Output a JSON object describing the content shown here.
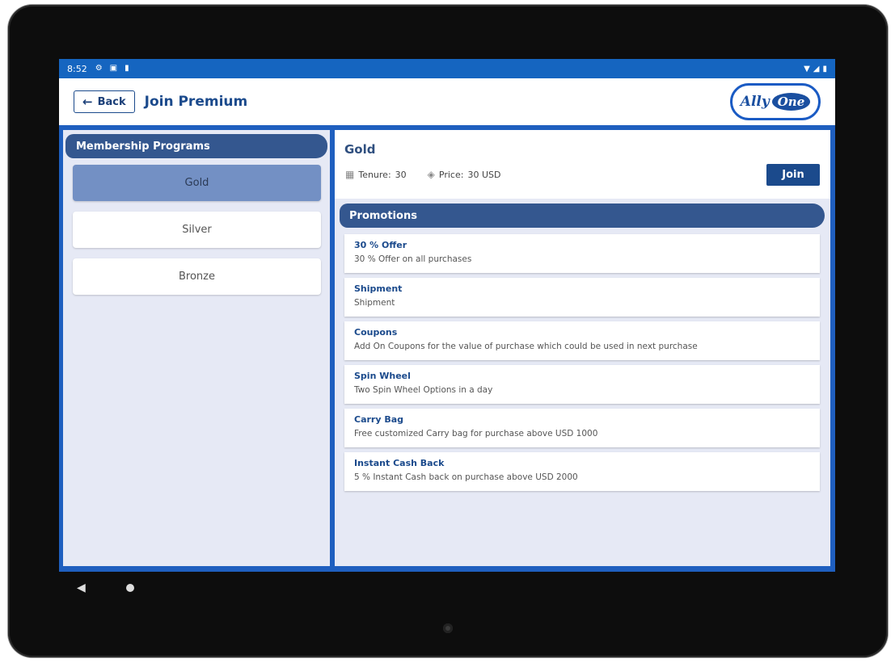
{
  "status_bar": {
    "time": "8:52",
    "icons": [
      "gear-icon",
      "a-icon",
      "sd-card-icon"
    ],
    "right_icons": [
      "wifi-icon",
      "signal-icon",
      "battery-icon"
    ]
  },
  "header": {
    "back_label": "Back",
    "title": "Join Premium",
    "logo_text": "Ally",
    "logo_badge": "One"
  },
  "left_panel": {
    "header": "Membership Programs",
    "programs": [
      {
        "label": "Gold",
        "selected": true
      },
      {
        "label": "Silver",
        "selected": false
      },
      {
        "label": "Bronze",
        "selected": false
      }
    ]
  },
  "detail": {
    "title": "Gold",
    "tenure_label": "Tenure:",
    "tenure_value": "30",
    "price_label": "Price:",
    "price_value": "30 USD",
    "join_label": "Join"
  },
  "promotions": {
    "header": "Promotions",
    "items": [
      {
        "title": "30 % Offer",
        "desc": "30 % Offer on all purchases"
      },
      {
        "title": "Shipment",
        "desc": "Shipment"
      },
      {
        "title": "Coupons",
        "desc": "Add On Coupons for the value of purchase which could be used in next purchase"
      },
      {
        "title": "Spin Wheel",
        "desc": "Two Spin Wheel Options in a day"
      },
      {
        "title": "Carry Bag",
        "desc": "Free customized Carry bag for purchase above USD 1000"
      },
      {
        "title": "Instant Cash Back",
        "desc": "5 % Instant Cash back on purchase above USD 2000"
      }
    ]
  },
  "colors": {
    "accent": "#1b4a8c",
    "header_band": "#34578f",
    "selected_item": "#7390c4",
    "status_bar": "#1565c0"
  }
}
